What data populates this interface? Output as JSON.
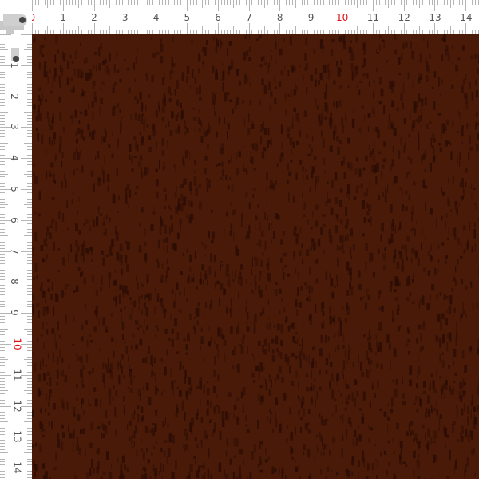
{
  "ruler": {
    "unit_labels": [
      "0",
      "1",
      "2",
      "3",
      "4",
      "5",
      "6",
      "7",
      "8",
      "9",
      "10",
      "11",
      "12",
      "13",
      "14"
    ],
    "highlight_labels": [
      "0",
      "10"
    ],
    "highlight_color": "#e01010",
    "tick_color": "#b5b5b5"
  },
  "swatch": {
    "base_color": "#4a1a08",
    "dark_color": "#2a0c04",
    "texture": "woven linen"
  }
}
